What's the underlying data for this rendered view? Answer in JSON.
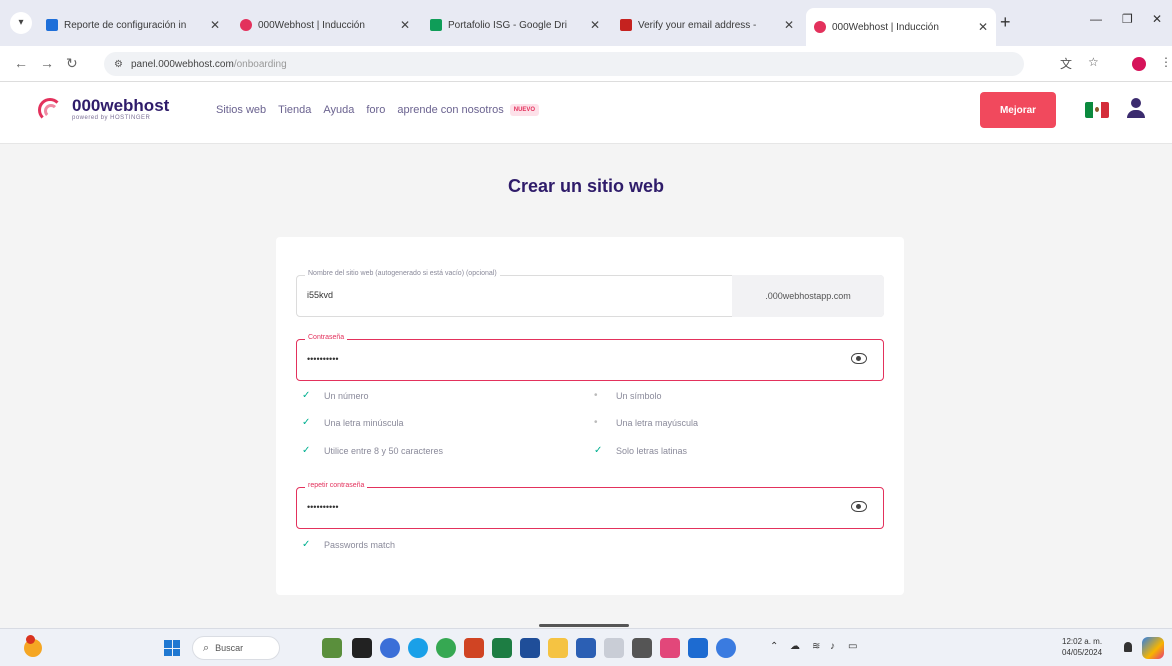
{
  "browser": {
    "tabs": [
      {
        "title": "Reporte de configuración in",
        "color": "#1e6fd9"
      },
      {
        "title": "000Webhost | Inducción",
        "color": "#e3315c"
      },
      {
        "title": "Portafolio ISG - Google Dri",
        "color": "#0f9d58"
      },
      {
        "title": "Verify your email address -",
        "color": "#c5221f"
      },
      {
        "title": "000Webhost | Inducción",
        "color": "#e3315c"
      }
    ],
    "url_host": "panel.000webhost.com",
    "url_path": "/onboarding"
  },
  "site": {
    "brand": "000webhost",
    "brand_sub": "powered by HOSTINGER",
    "nav": [
      "Sitios web",
      "Tienda",
      "Ayuda",
      "foro",
      "aprende con nosotros"
    ],
    "nav_badge": "NUEVO",
    "upgrade_label": "Mejorar",
    "accent": "#e3315c"
  },
  "form": {
    "title": "Crear un sitio web",
    "site_name_label": "Nombre del sitio web (autogenerado si está vacío) (opcional)",
    "site_name_value": "i55kvd",
    "domain_suffix": ".000webhostapp.com",
    "password_label": "Contraseña",
    "password_value": "••••••••••",
    "rules": [
      {
        "text": "Un número",
        "ok": true
      },
      {
        "text": "Un símbolo",
        "ok": false
      },
      {
        "text": "Una letra minúscula",
        "ok": true
      },
      {
        "text": "Una letra mayúscula",
        "ok": false
      },
      {
        "text": "Utilice entre 8 y 50 caracteres",
        "ok": true
      },
      {
        "text": "Solo letras latinas",
        "ok": true
      }
    ],
    "repeat_label": "repetir contraseña",
    "repeat_value": "••••••••••",
    "match_text": "Passwords match"
  },
  "taskbar": {
    "search_label": "Buscar",
    "time": "12:02 a. m.",
    "date": "04/05/2024"
  }
}
